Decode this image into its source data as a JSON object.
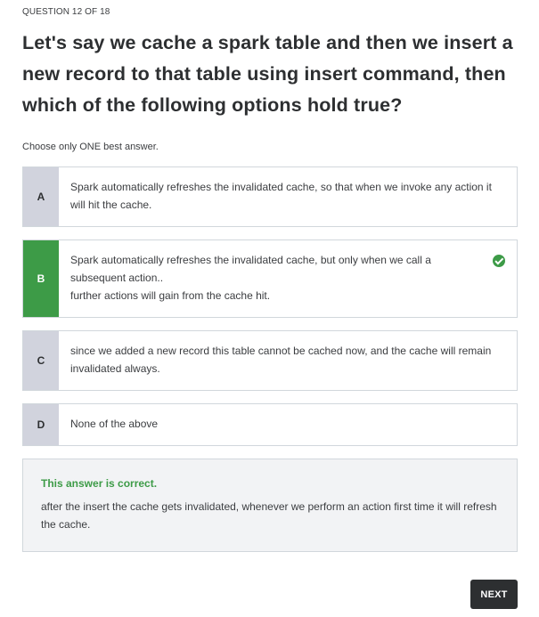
{
  "counter": "QUESTION 12 OF 18",
  "question": "Let's say we cache a spark table and then we insert a new record to that table using insert command, then which of the following options hold true?",
  "instruction": "Choose only ONE best answer.",
  "options": [
    {
      "letter": "A",
      "text": "Spark automatically refreshes the invalidated cache, so that when we invoke any action it will hit the cache."
    },
    {
      "letter": "B",
      "text": "Spark automatically refreshes the invalidated cache, but only when we call a subsequent action..\nfurther actions will gain from the cache hit."
    },
    {
      "letter": "C",
      "text": "since we added a new record this table cannot be cached now, and the cache will remain invalidated always."
    },
    {
      "letter": "D",
      "text": "None of the above"
    }
  ],
  "feedback": {
    "title": "This answer is correct.",
    "explanation": "after the insert the cache gets invalidated, whenever we perform an action first time it will refresh the cache."
  },
  "next_label": "NEXT",
  "colors": {
    "correct": "#3d9b47",
    "letter_bg": "#d1d3dd",
    "button_bg": "#2d2f31"
  },
  "icons": {
    "correct_mark": "check-circle-icon"
  }
}
